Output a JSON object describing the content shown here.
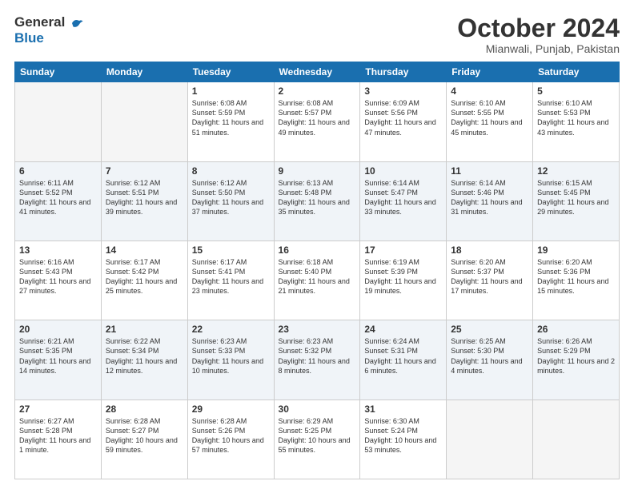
{
  "logo": {
    "line1": "General",
    "line2": "Blue"
  },
  "title": "October 2024",
  "location": "Mianwali, Punjab, Pakistan",
  "days_of_week": [
    "Sunday",
    "Monday",
    "Tuesday",
    "Wednesday",
    "Thursday",
    "Friday",
    "Saturday"
  ],
  "weeks": [
    [
      {
        "day": "",
        "sunrise": "",
        "sunset": "",
        "daylight": ""
      },
      {
        "day": "",
        "sunrise": "",
        "sunset": "",
        "daylight": ""
      },
      {
        "day": "1",
        "sunrise": "Sunrise: 6:08 AM",
        "sunset": "Sunset: 5:59 PM",
        "daylight": "Daylight: 11 hours and 51 minutes."
      },
      {
        "day": "2",
        "sunrise": "Sunrise: 6:08 AM",
        "sunset": "Sunset: 5:57 PM",
        "daylight": "Daylight: 11 hours and 49 minutes."
      },
      {
        "day": "3",
        "sunrise": "Sunrise: 6:09 AM",
        "sunset": "Sunset: 5:56 PM",
        "daylight": "Daylight: 11 hours and 47 minutes."
      },
      {
        "day": "4",
        "sunrise": "Sunrise: 6:10 AM",
        "sunset": "Sunset: 5:55 PM",
        "daylight": "Daylight: 11 hours and 45 minutes."
      },
      {
        "day": "5",
        "sunrise": "Sunrise: 6:10 AM",
        "sunset": "Sunset: 5:53 PM",
        "daylight": "Daylight: 11 hours and 43 minutes."
      }
    ],
    [
      {
        "day": "6",
        "sunrise": "Sunrise: 6:11 AM",
        "sunset": "Sunset: 5:52 PM",
        "daylight": "Daylight: 11 hours and 41 minutes."
      },
      {
        "day": "7",
        "sunrise": "Sunrise: 6:12 AM",
        "sunset": "Sunset: 5:51 PM",
        "daylight": "Daylight: 11 hours and 39 minutes."
      },
      {
        "day": "8",
        "sunrise": "Sunrise: 6:12 AM",
        "sunset": "Sunset: 5:50 PM",
        "daylight": "Daylight: 11 hours and 37 minutes."
      },
      {
        "day": "9",
        "sunrise": "Sunrise: 6:13 AM",
        "sunset": "Sunset: 5:48 PM",
        "daylight": "Daylight: 11 hours and 35 minutes."
      },
      {
        "day": "10",
        "sunrise": "Sunrise: 6:14 AM",
        "sunset": "Sunset: 5:47 PM",
        "daylight": "Daylight: 11 hours and 33 minutes."
      },
      {
        "day": "11",
        "sunrise": "Sunrise: 6:14 AM",
        "sunset": "Sunset: 5:46 PM",
        "daylight": "Daylight: 11 hours and 31 minutes."
      },
      {
        "day": "12",
        "sunrise": "Sunrise: 6:15 AM",
        "sunset": "Sunset: 5:45 PM",
        "daylight": "Daylight: 11 hours and 29 minutes."
      }
    ],
    [
      {
        "day": "13",
        "sunrise": "Sunrise: 6:16 AM",
        "sunset": "Sunset: 5:43 PM",
        "daylight": "Daylight: 11 hours and 27 minutes."
      },
      {
        "day": "14",
        "sunrise": "Sunrise: 6:17 AM",
        "sunset": "Sunset: 5:42 PM",
        "daylight": "Daylight: 11 hours and 25 minutes."
      },
      {
        "day": "15",
        "sunrise": "Sunrise: 6:17 AM",
        "sunset": "Sunset: 5:41 PM",
        "daylight": "Daylight: 11 hours and 23 minutes."
      },
      {
        "day": "16",
        "sunrise": "Sunrise: 6:18 AM",
        "sunset": "Sunset: 5:40 PM",
        "daylight": "Daylight: 11 hours and 21 minutes."
      },
      {
        "day": "17",
        "sunrise": "Sunrise: 6:19 AM",
        "sunset": "Sunset: 5:39 PM",
        "daylight": "Daylight: 11 hours and 19 minutes."
      },
      {
        "day": "18",
        "sunrise": "Sunrise: 6:20 AM",
        "sunset": "Sunset: 5:37 PM",
        "daylight": "Daylight: 11 hours and 17 minutes."
      },
      {
        "day": "19",
        "sunrise": "Sunrise: 6:20 AM",
        "sunset": "Sunset: 5:36 PM",
        "daylight": "Daylight: 11 hours and 15 minutes."
      }
    ],
    [
      {
        "day": "20",
        "sunrise": "Sunrise: 6:21 AM",
        "sunset": "Sunset: 5:35 PM",
        "daylight": "Daylight: 11 hours and 14 minutes."
      },
      {
        "day": "21",
        "sunrise": "Sunrise: 6:22 AM",
        "sunset": "Sunset: 5:34 PM",
        "daylight": "Daylight: 11 hours and 12 minutes."
      },
      {
        "day": "22",
        "sunrise": "Sunrise: 6:23 AM",
        "sunset": "Sunset: 5:33 PM",
        "daylight": "Daylight: 11 hours and 10 minutes."
      },
      {
        "day": "23",
        "sunrise": "Sunrise: 6:23 AM",
        "sunset": "Sunset: 5:32 PM",
        "daylight": "Daylight: 11 hours and 8 minutes."
      },
      {
        "day": "24",
        "sunrise": "Sunrise: 6:24 AM",
        "sunset": "Sunset: 5:31 PM",
        "daylight": "Daylight: 11 hours and 6 minutes."
      },
      {
        "day": "25",
        "sunrise": "Sunrise: 6:25 AM",
        "sunset": "Sunset: 5:30 PM",
        "daylight": "Daylight: 11 hours and 4 minutes."
      },
      {
        "day": "26",
        "sunrise": "Sunrise: 6:26 AM",
        "sunset": "Sunset: 5:29 PM",
        "daylight": "Daylight: 11 hours and 2 minutes."
      }
    ],
    [
      {
        "day": "27",
        "sunrise": "Sunrise: 6:27 AM",
        "sunset": "Sunset: 5:28 PM",
        "daylight": "Daylight: 11 hours and 1 minute."
      },
      {
        "day": "28",
        "sunrise": "Sunrise: 6:28 AM",
        "sunset": "Sunset: 5:27 PM",
        "daylight": "Daylight: 10 hours and 59 minutes."
      },
      {
        "day": "29",
        "sunrise": "Sunrise: 6:28 AM",
        "sunset": "Sunset: 5:26 PM",
        "daylight": "Daylight: 10 hours and 57 minutes."
      },
      {
        "day": "30",
        "sunrise": "Sunrise: 6:29 AM",
        "sunset": "Sunset: 5:25 PM",
        "daylight": "Daylight: 10 hours and 55 minutes."
      },
      {
        "day": "31",
        "sunrise": "Sunrise: 6:30 AM",
        "sunset": "Sunset: 5:24 PM",
        "daylight": "Daylight: 10 hours and 53 minutes."
      },
      {
        "day": "",
        "sunrise": "",
        "sunset": "",
        "daylight": ""
      },
      {
        "day": "",
        "sunrise": "",
        "sunset": "",
        "daylight": ""
      }
    ]
  ]
}
